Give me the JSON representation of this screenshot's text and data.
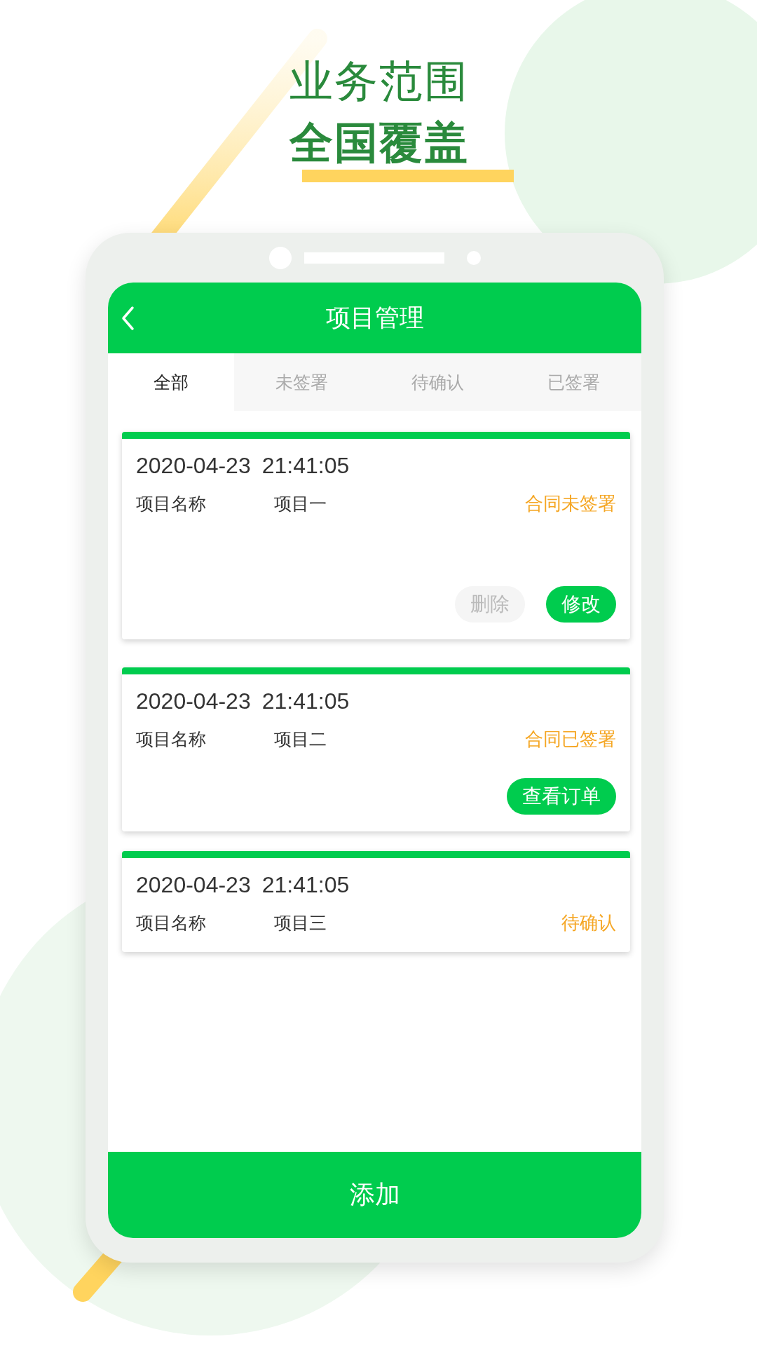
{
  "headline": {
    "line1": "业务范围",
    "line2": "全国覆盖"
  },
  "app": {
    "title": "项目管理"
  },
  "tabs": [
    {
      "label": "全部",
      "selected": true
    },
    {
      "label": "未签署",
      "selected": false
    },
    {
      "label": "待确认",
      "selected": false
    },
    {
      "label": "已签署",
      "selected": false
    }
  ],
  "projects": [
    {
      "date": "2020-04-23",
      "time": "21:41:05",
      "label": "项目名称",
      "name": "项目一",
      "status": "合同未签署",
      "actions": [
        {
          "label": "删除",
          "kind": "secondary"
        },
        {
          "label": "修改",
          "kind": "primary"
        }
      ]
    },
    {
      "date": "2020-04-23",
      "time": "21:41:05",
      "label": "项目名称",
      "name": "项目二",
      "status": "合同已签署",
      "actions": [
        {
          "label": "查看订单",
          "kind": "primary"
        }
      ]
    },
    {
      "date": "2020-04-23",
      "time": "21:41:05",
      "label": "项目名称",
      "name": "项目三",
      "status": "待确认"
    }
  ],
  "add_button": "添加"
}
